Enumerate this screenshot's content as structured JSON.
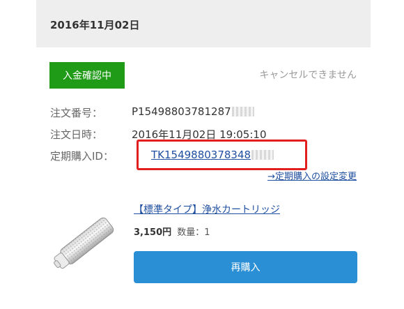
{
  "order": {
    "date": "2016年11月02日",
    "status_badge": "入金確認中",
    "cancel_note": "キャンセルできません",
    "fields": [
      {
        "label": "注文番号：",
        "value": "P15498803781287"
      },
      {
        "label": "注文日時：",
        "value": "2016年11月02日 19:05:10"
      },
      {
        "label": "定期購入ID：",
        "value": "TK1549880378348"
      }
    ],
    "subscription_setting_link": "→定期購入の設定変更"
  },
  "product": {
    "name": "【標準タイプ】浄水カートリッジ",
    "price": "3,150円",
    "quantity": "数量：1",
    "image_icon": "water-filter-cartridge-icon"
  },
  "actions": {
    "rebuy_label": "再購入"
  },
  "colors": {
    "status_green": "#1f9b17",
    "link_blue": "#1f4fa0",
    "button_blue": "#2b8fd6",
    "highlight_red": "#e11f1f"
  }
}
